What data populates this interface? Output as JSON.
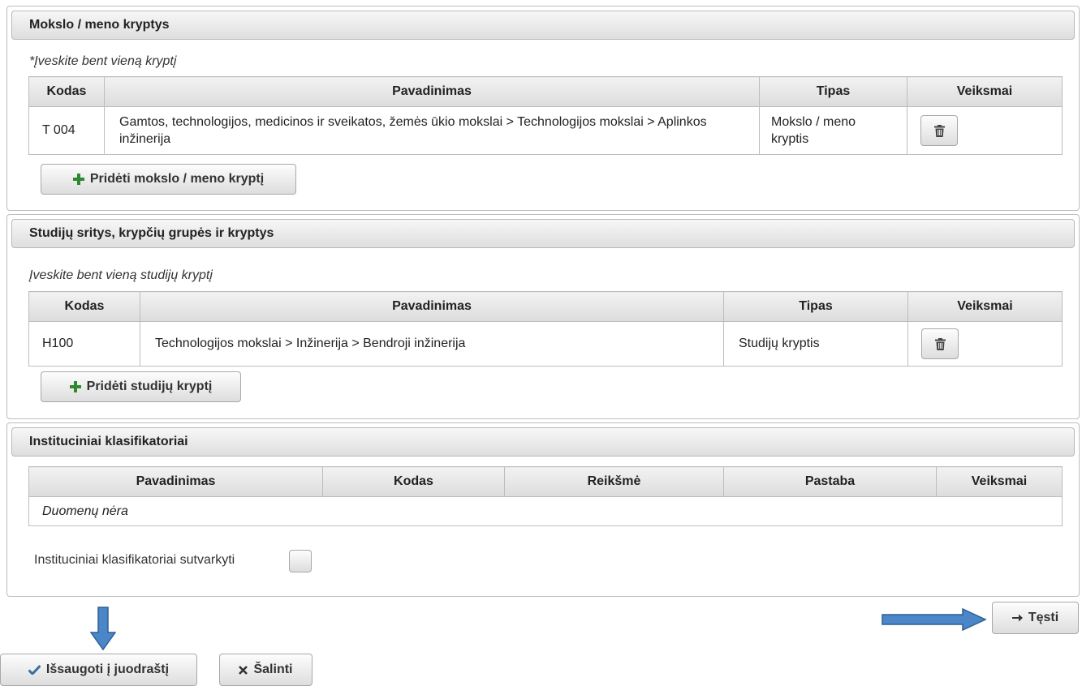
{
  "sections": {
    "mokslo": {
      "title": "Mokslo / meno kryptys",
      "hint": "*Įveskite bent vieną kryptį",
      "columns": [
        "Kodas",
        "Pavadinimas",
        "Tipas",
        "Veiksmai"
      ],
      "rows": [
        {
          "kodas": "T 004",
          "pavadinimas": "Gamtos, technologijos, medicinos ir sveikatos, žemės ūkio mokslai > Technologijos mokslai > Aplinkos inžinerija",
          "tipas": "Mokslo / meno kryptis"
        }
      ],
      "add_label": "Pridėti mokslo / meno kryptį"
    },
    "studiju": {
      "title": "Studijų sritys, krypčių grupės ir kryptys",
      "hint": "Įveskite bent vieną studijų kryptį",
      "columns": [
        "Kodas",
        "Pavadinimas",
        "Tipas",
        "Veiksmai"
      ],
      "rows": [
        {
          "kodas": "H100",
          "pavadinimas": "Technologijos mokslai > Inžinerija > Bendroji inžinerija",
          "tipas": "Studijų kryptis"
        }
      ],
      "add_label": "Pridėti studijų kryptį"
    },
    "instituciniai": {
      "title": "Instituciniai klasifikatoriai",
      "columns": [
        "Pavadinimas",
        "Kodas",
        "Reikšmė",
        "Pastaba",
        "Veiksmai"
      ],
      "empty_text": "Duomenų nėra",
      "checkbox_label": "Instituciniai klasifikatoriai sutvarkyti",
      "checkbox_checked": false
    }
  },
  "actions": {
    "continue_label": "Tęsti",
    "save_label": "Išsaugoti į juodraštį",
    "delete_label": "Šalinti"
  },
  "icons": {
    "add": "plus-icon",
    "delete": "trash-icon",
    "continue": "arrow-right-icon",
    "save": "checkmark-icon",
    "remove": "x-icon",
    "annotation_right": "blue-arrow-right-icon",
    "annotation_down": "blue-arrow-down-icon"
  },
  "colors": {
    "plus": "#2f8a2f",
    "annotation_arrow": "#4a86c8"
  }
}
